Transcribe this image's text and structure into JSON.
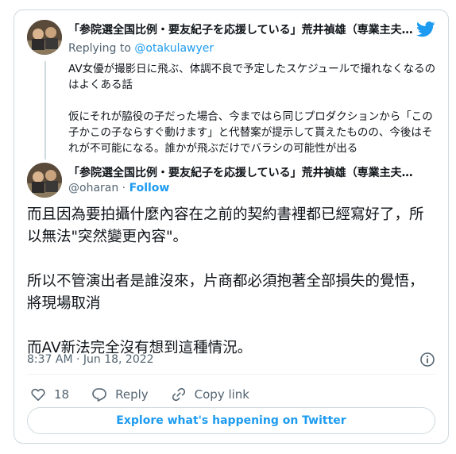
{
  "quoted_tweet": {
    "display_name": "「参院選全国比例・要友紀子を応援している」荒井禎雄（専業主夫を志す",
    "replying_prefix": "Replying to ",
    "replying_handle": "@otakulawyer",
    "paragraphs": [
      "AV女優が撮影日に飛ぶ、体調不良で予定したスケジュールで撮れなくなるのはよくある話",
      "仮にそれが脇役の子だった場合、今まではら同じプロダクションから「この子かこの子ならすぐ動けます」と代替案が提示して貰えたものの、今後はそれが不可能になる。誰かが飛ぶだけでバラシの可能性が出る"
    ]
  },
  "main_tweet": {
    "display_name": "「参院選全国比例・要友紀子を応援している」荒井禎雄（専業主夫…",
    "handle": "@oharan",
    "separator": " · ",
    "follow_label": "Follow",
    "paragraphs": [
      "而且因為要拍攝什麼內容在之前的契約書裡都已經寫好了，所以無法\"突然變更內容\"。",
      "所以不管演出者是誰沒來，片商都必須抱著全部損失的覺悟，將現場取消",
      "而AV新法完全沒有想到這種情況。"
    ],
    "timestamp": "8:37 AM · Jun 18, 2022"
  },
  "actions": {
    "like_count": "18",
    "reply_label": "Reply",
    "copy_link_label": "Copy link"
  },
  "explore_label": "Explore what's happening on Twitter",
  "colors": {
    "accent": "#1d9bf0",
    "secondary_text": "#536471",
    "border": "#cfd9de"
  },
  "icons": [
    "twitter-bird-icon",
    "info-icon",
    "heart-icon",
    "reply-icon",
    "link-icon"
  ]
}
